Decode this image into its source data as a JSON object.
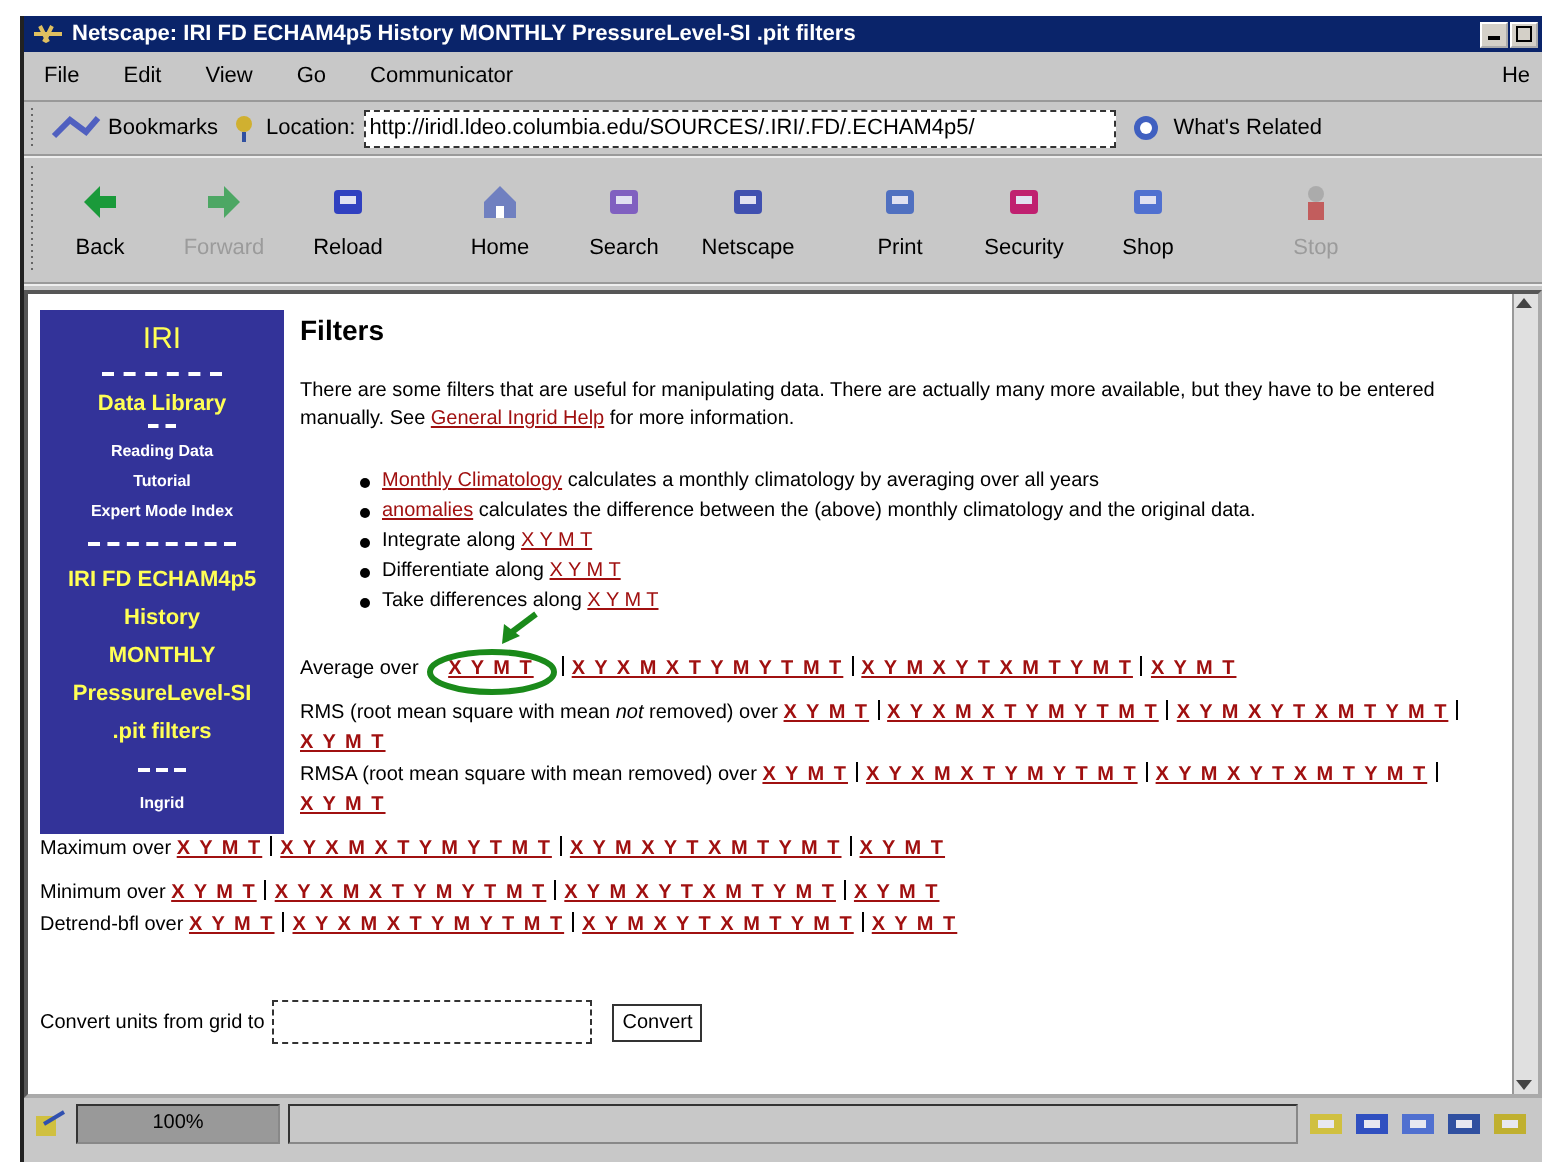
{
  "window": {
    "title": "Netscape: IRI FD ECHAM4p5 History MONTHLY PressureLevel-SI .pit filters"
  },
  "menu": [
    "File",
    "Edit",
    "View",
    "Go",
    "Communicator",
    "He"
  ],
  "location_bar": {
    "bookmarks": "Bookmarks",
    "location_label": "Location:",
    "url": "http://iridl.ldeo.columbia.edu/SOURCES/.IRI/.FD/.ECHAM4p5/",
    "related": "What's Related"
  },
  "toolbar": [
    {
      "label": "Back",
      "disabled": false
    },
    {
      "label": "Forward",
      "disabled": true
    },
    {
      "label": "Reload",
      "disabled": false
    },
    {
      "label": "Home",
      "disabled": false
    },
    {
      "label": "Search",
      "disabled": false
    },
    {
      "label": "Netscape",
      "disabled": false
    },
    {
      "label": "Print",
      "disabled": false
    },
    {
      "label": "Security",
      "disabled": false
    },
    {
      "label": "Shop",
      "disabled": false
    },
    {
      "label": "Stop",
      "disabled": true
    }
  ],
  "sidebar": {
    "title": "IRI",
    "top_links": [
      "Data Library",
      "Reading Data",
      "Tutorial",
      "Expert Mode Index"
    ],
    "dataset": [
      "IRI FD ECHAM4p5",
      "History",
      "MONTHLY",
      "PressureLevel-SI",
      ".pit filters"
    ],
    "footer": "Ingrid"
  },
  "heading": "Filters",
  "intro": [
    {
      "text": "There are some filters that are useful for manipulating data. There are actually many more available, but they have to be entered manually. See ",
      "link": false
    },
    {
      "text": "General Ingrid Help",
      "link": true
    },
    {
      "text": " for more information.",
      "link": false
    }
  ],
  "bullets": [
    [
      {
        "text": "Monthly Climatology",
        "link": true
      },
      {
        "text": " calculates a monthly climatology by averaging over all years",
        "link": false
      }
    ],
    [
      {
        "text": "anomalies",
        "link": true
      },
      {
        "text": " calculates the difference between the (above) monthly climatology and the original data.",
        "link": false
      }
    ],
    [
      {
        "text": "Integrate along ",
        "link": false
      },
      {
        "text": "X Y M T",
        "link": true
      }
    ],
    [
      {
        "text": "Differentiate along ",
        "link": false
      },
      {
        "text": "X Y M T",
        "link": true
      }
    ],
    [
      {
        "text": "Take differences along ",
        "link": false
      },
      {
        "text": "X Y M T",
        "link": true
      }
    ]
  ],
  "filters": [
    {
      "label": "Average over ",
      "links": [
        "X Y M T",
        "X Y X M X T Y M Y T M T",
        "X Y M X Y T X M T Y M T",
        "X Y M T"
      ]
    },
    {
      "label": "RMS (root mean square with mean *not* removed) over ",
      "links": [
        "X Y M T",
        "X Y X M X T Y M Y T M T",
        "X Y M X Y T X M T Y M T",
        "X Y M T"
      ]
    },
    {
      "label": "RMSA (root mean square with mean removed) over ",
      "links": [
        "X Y M T",
        "X Y X M X T Y M Y T M T",
        "X Y M X Y T X M T Y M T",
        "X Y M T"
      ]
    },
    {
      "label": "Maximum over ",
      "links": [
        "X Y M T",
        "X Y X M X T Y M Y T M T",
        "X Y M X Y T X M T Y M T",
        "X Y M T"
      ]
    },
    {
      "label": "Minimum over ",
      "links": [
        "X Y M T",
        "X Y X M X T Y M Y T M T",
        "X Y M X Y T X M T Y M T",
        "X Y M T"
      ]
    },
    {
      "label": "Detrend-bfl over ",
      "links": [
        "X Y M T",
        "X Y X M X T Y M Y T M T",
        "X Y M X Y T X M T Y M T",
        "X Y M T"
      ]
    }
  ],
  "convert": {
    "label": "Convert units from grid to",
    "button": "Convert"
  },
  "status_bar": {
    "progress": "100%",
    "level": 1
  }
}
